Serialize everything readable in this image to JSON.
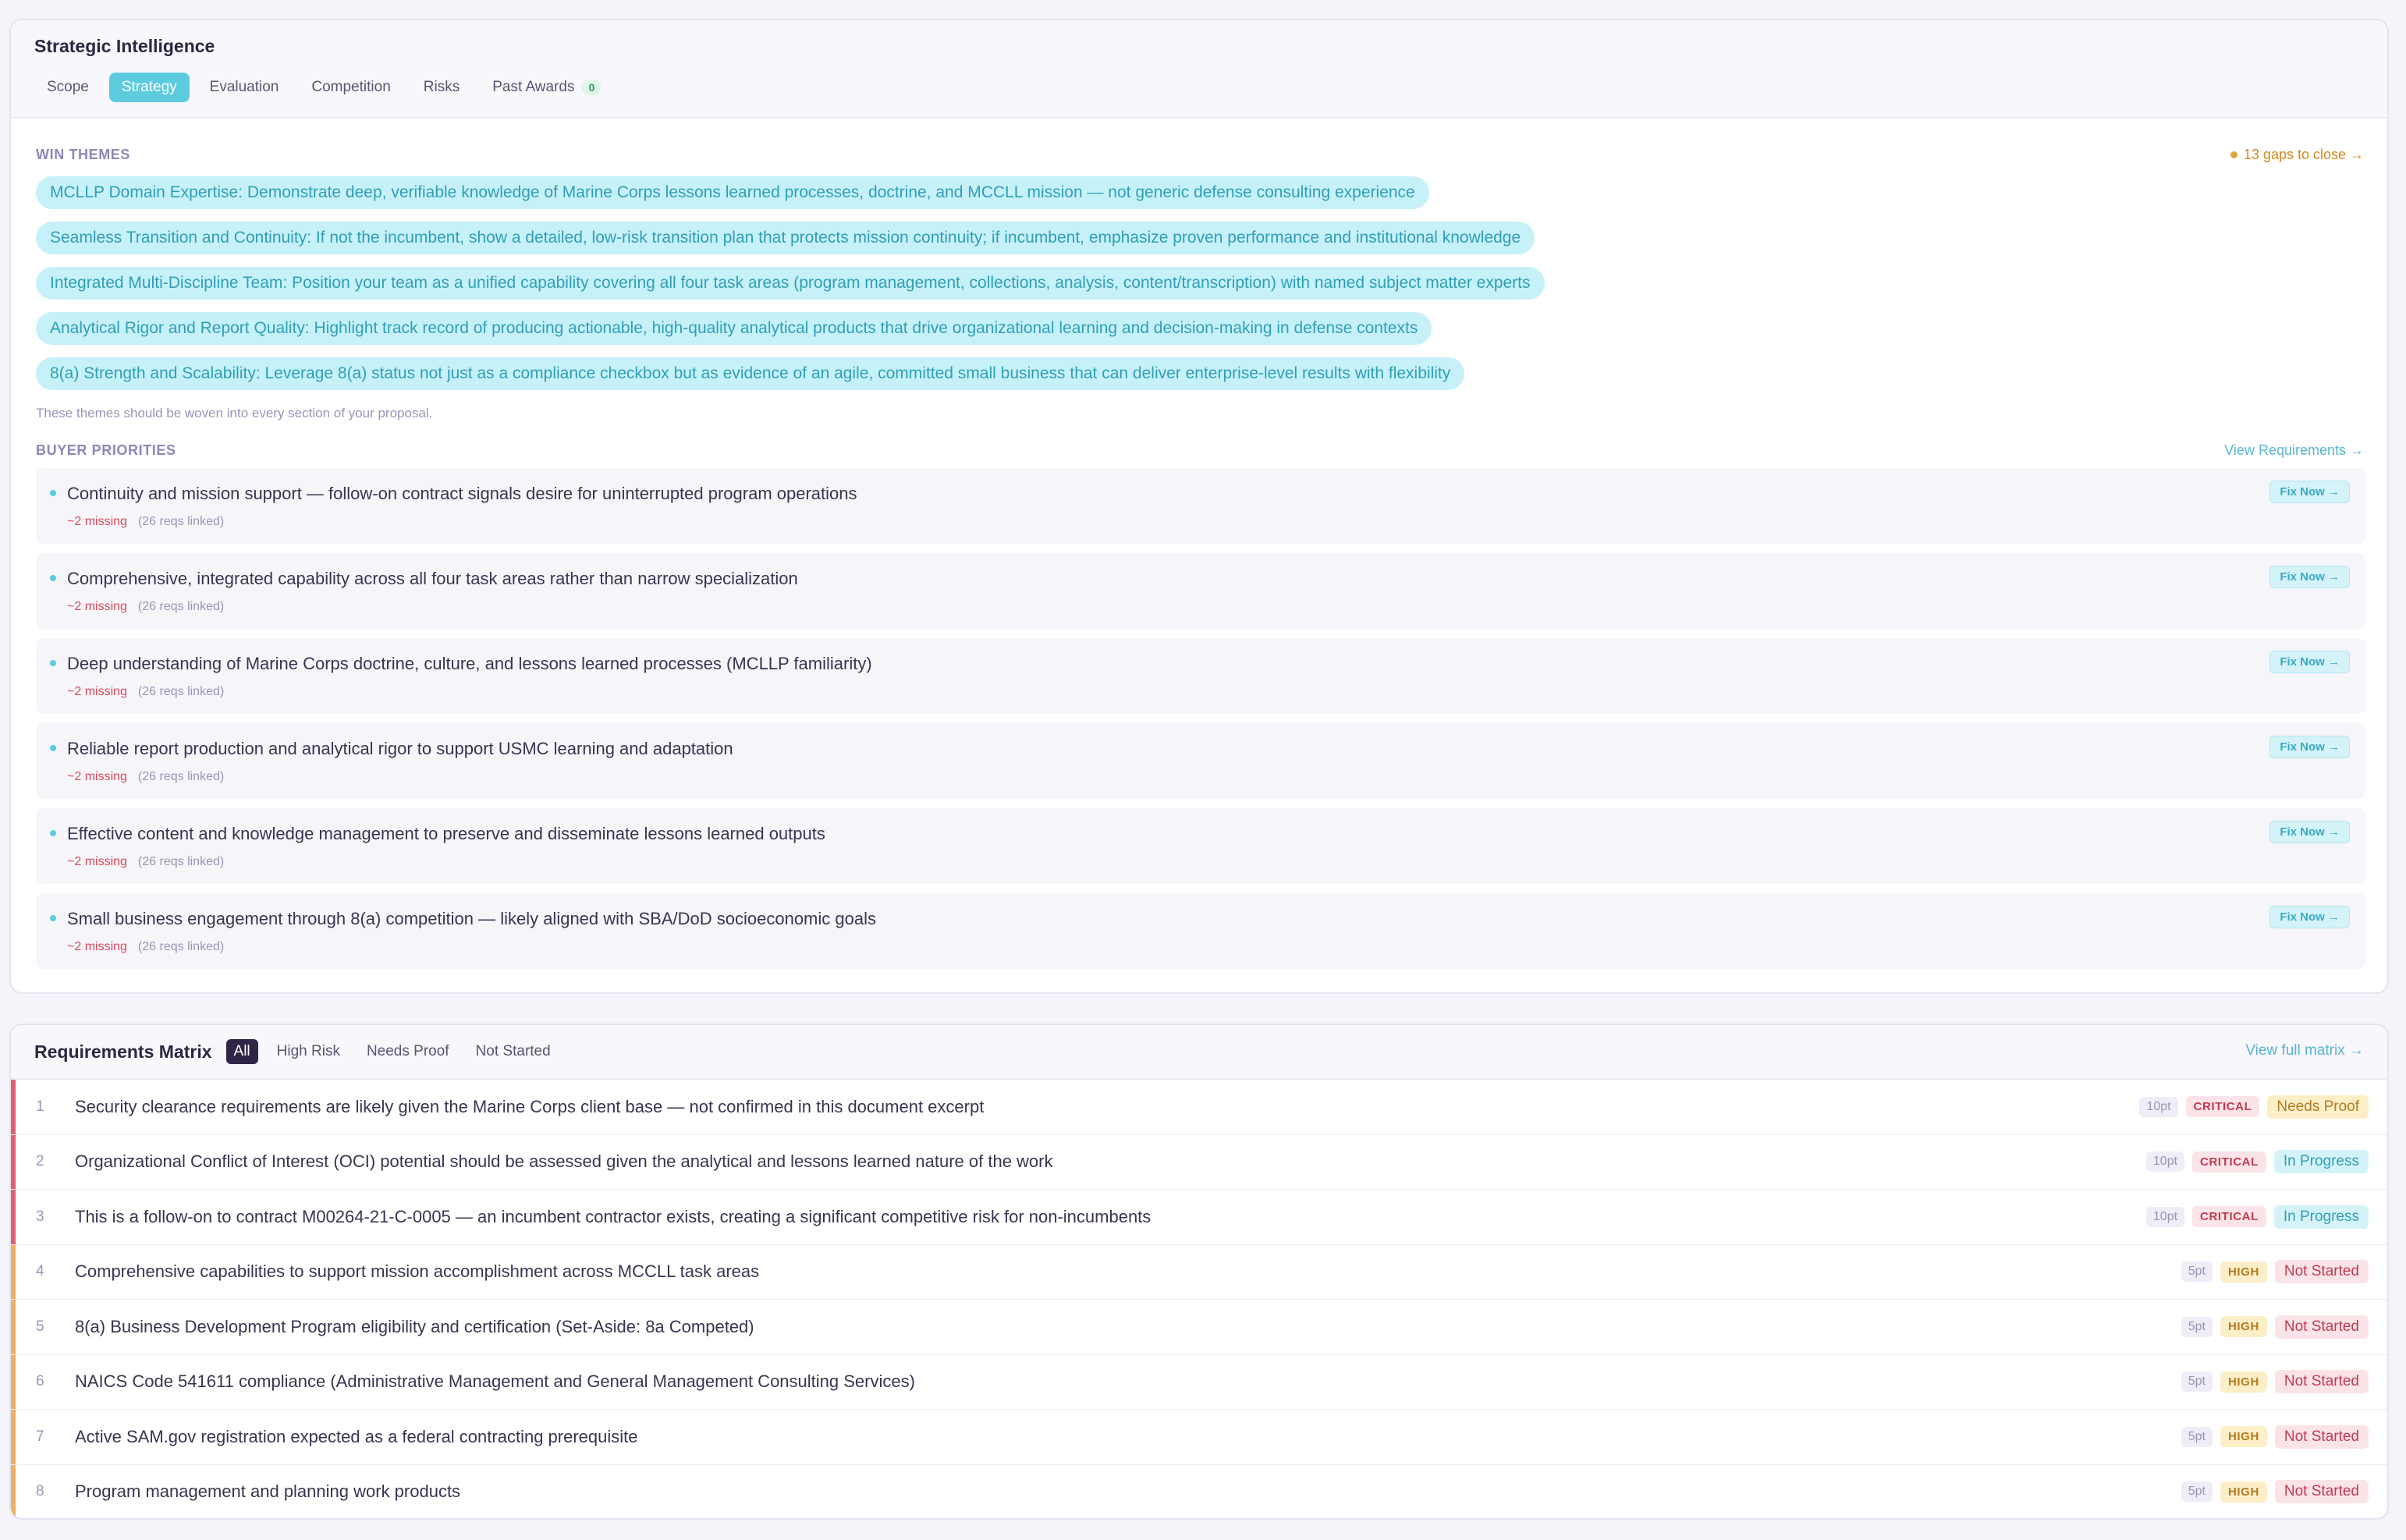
{
  "intel": {
    "title": "Strategic Intelligence",
    "tabs": [
      {
        "label": "Scope"
      },
      {
        "label": "Strategy"
      },
      {
        "label": "Evaluation"
      },
      {
        "label": "Competition"
      },
      {
        "label": "Risks"
      },
      {
        "label": "Past Awards",
        "count": "0"
      }
    ],
    "win_themes": {
      "label": "WIN THEMES",
      "gaps_link": "13 gaps to close →",
      "themes": [
        "MCLLP Domain Expertise: Demonstrate deep, verifiable knowledge of Marine Corps lessons learned processes, doctrine, and MCCLL mission — not generic defense consulting experience",
        "Seamless Transition and Continuity: If not the incumbent, show a detailed, low-risk transition plan that protects mission continuity; if incumbent, emphasize proven performance and institutional knowledge",
        "Integrated Multi-Discipline Team: Position your team as a unified capability covering all four task areas (program management, collections, analysis, content/transcription) with named subject matter experts",
        "Analytical Rigor and Report Quality: Highlight track record of producing actionable, high-quality analytical products that drive organizational learning and decision-making in defense contexts",
        "8(a) Strength and Scalability: Leverage 8(a) status not just as a compliance checkbox but as evidence of an agile, committed small business that can deliver enterprise-level results with flexibility"
      ],
      "note": "These themes should be woven into every section of your proposal."
    },
    "buyer_priorities": {
      "label": "BUYER PRIORITIES",
      "view_link": "View Requirements →",
      "fix_label": "Fix Now →",
      "items": [
        {
          "text": "Continuity and mission support — follow-on contract signals desire for uninterrupted program operations",
          "missing": "~2 missing",
          "linked": "(26 reqs linked)"
        },
        {
          "text": "Comprehensive, integrated capability across all four task areas rather than narrow specialization",
          "missing": "~2 missing",
          "linked": "(26 reqs linked)"
        },
        {
          "text": "Deep understanding of Marine Corps doctrine, culture, and lessons learned processes (MCLLP familiarity)",
          "missing": "~2 missing",
          "linked": "(26 reqs linked)"
        },
        {
          "text": "Reliable report production and analytical rigor to support USMC learning and adaptation",
          "missing": "~2 missing",
          "linked": "(26 reqs linked)"
        },
        {
          "text": "Effective content and knowledge management to preserve and disseminate lessons learned outputs",
          "missing": "~2 missing",
          "linked": "(26 reqs linked)"
        },
        {
          "text": "Small business engagement through 8(a) competition — likely aligned with SBA/DoD socioeconomic goals",
          "missing": "~2 missing",
          "linked": "(26 reqs linked)"
        }
      ]
    }
  },
  "matrix": {
    "title": "Requirements Matrix",
    "filters": [
      "All",
      "High Risk",
      "Needs Proof",
      "Not Started"
    ],
    "full_link": "View full matrix →",
    "colors": {
      "critical": "#e06070",
      "high": "#f0b060"
    },
    "rows": [
      {
        "num": "1",
        "text": "Security clearance requirements are likely given the Marine Corps client base — not confirmed in this document excerpt",
        "pts": "10pt",
        "severity": "CRITICAL",
        "status": "Needs Proof"
      },
      {
        "num": "2",
        "text": "Organizational Conflict of Interest (OCI) potential should be assessed given the analytical and lessons learned nature of the work",
        "pts": "10pt",
        "severity": "CRITICAL",
        "status": "In Progress"
      },
      {
        "num": "3",
        "text": "This is a follow-on to contract M00264-21-C-0005 — an incumbent contractor exists, creating a significant competitive risk for non-incumbents",
        "pts": "10pt",
        "severity": "CRITICAL",
        "status": "In Progress"
      },
      {
        "num": "4",
        "text": "Comprehensive capabilities to support mission accomplishment across MCCLL task areas",
        "pts": "5pt",
        "severity": "HIGH",
        "status": "Not Started"
      },
      {
        "num": "5",
        "text": "8(a) Business Development Program eligibility and certification (Set-Aside: 8a Competed)",
        "pts": "5pt",
        "severity": "HIGH",
        "status": "Not Started"
      },
      {
        "num": "6",
        "text": "NAICS Code 541611 compliance (Administrative Management and General Management Consulting Services)",
        "pts": "5pt",
        "severity": "HIGH",
        "status": "Not Started"
      },
      {
        "num": "7",
        "text": "Active SAM.gov registration expected as a federal contracting prerequisite",
        "pts": "5pt",
        "severity": "HIGH",
        "status": "Not Started"
      },
      {
        "num": "8",
        "text": "Program management and planning work products",
        "pts": "5pt",
        "severity": "HIGH",
        "status": "Not Started"
      }
    ]
  }
}
